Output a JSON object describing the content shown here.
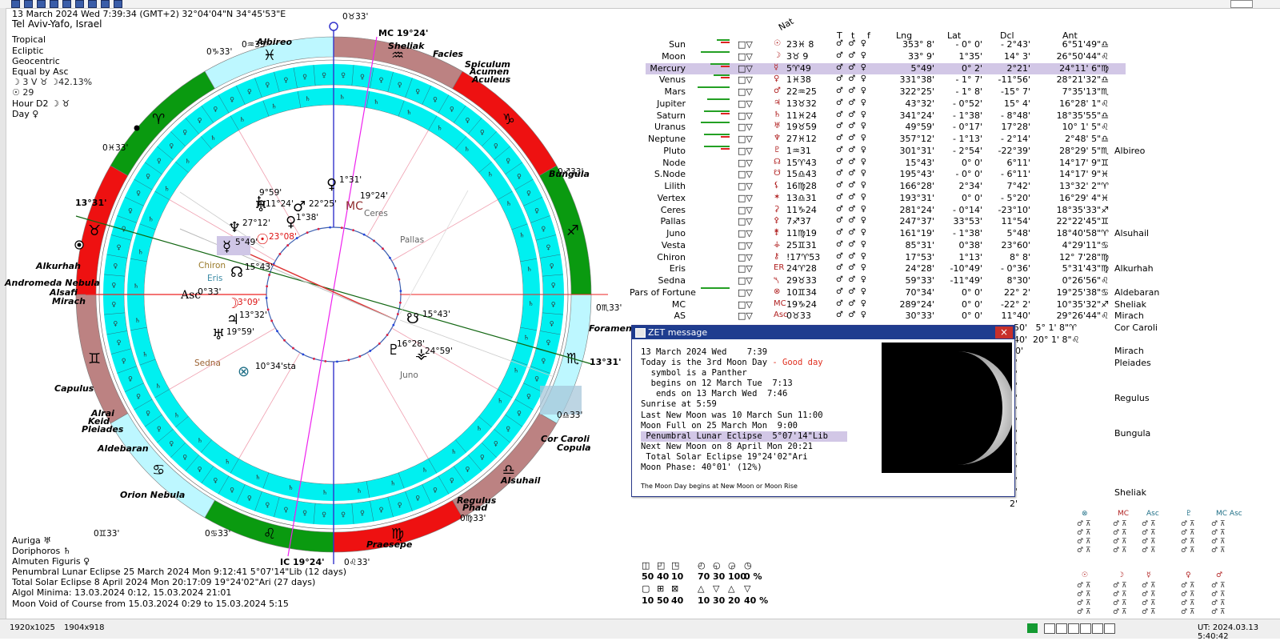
{
  "header": {
    "line1": "13 March 2024  Wed    7:39:34 (GMT+2) 32°04'04\"N  34°45'53\"E",
    "city": "Tel Aviv-Yafo, Israel",
    "settings": [
      "Tropical",
      "Ecliptic",
      "Geocentric",
      "Equal by Asc"
    ],
    "moon_info": "☽  3 V ♉ ☽42.13%",
    "sun_info": "☉  29",
    "hour": "Hour D2 ☽ ♉",
    "day": "Day ♀"
  },
  "wheel": {
    "asc_label": "Asc",
    "asc_deg": "0°33'",
    "mc_label": "MC 19°24'",
    "ic_label": "IC 19°24'",
    "cusp_labels": [
      "0♉33'",
      "0♊33'",
      "0♋33'",
      "0♌33'",
      "0♍33'",
      "0♎33'",
      "0♏33'",
      "0♐33'",
      "0♑33'",
      "0♒33'",
      "0♓33'"
    ],
    "side_degrees": [
      "13°31'",
      "13°31'"
    ],
    "planets": [
      {
        "glyph": "♄",
        "deg": "9°59'"
      },
      {
        "glyph": "♅",
        "deg": "11°24'"
      },
      {
        "glyph": "♂",
        "deg": "22°25'"
      },
      {
        "glyph": "♀",
        "deg": "1°38'"
      },
      {
        "glyph": "♆",
        "deg": "27°12'"
      },
      {
        "glyph": "☿",
        "deg": "5°49'"
      },
      {
        "glyph": "☉",
        "deg": "23°08'"
      },
      {
        "glyph": "☊",
        "deg": "15°43'"
      },
      {
        "glyph": "☽",
        "deg": "3°09'"
      },
      {
        "glyph": "♃",
        "deg": "13°32'"
      },
      {
        "glyph": "♅",
        "deg": "19°59'"
      },
      {
        "glyph": "⊗",
        "deg": "10°34'sta"
      },
      {
        "glyph": "☋",
        "deg": "15°43'"
      },
      {
        "glyph": "♇",
        "deg": "16°28'"
      },
      {
        "glyph": "⚶",
        "deg": "24°59'"
      },
      {
        "glyph": "♀",
        "deg": "1°31'"
      },
      {
        "glyph": "MC",
        "deg": "19°24'"
      }
    ],
    "small_labels": [
      "Chiron",
      "Eris",
      "Sedna",
      "Juno",
      "Ceres",
      "Pallas"
    ],
    "stars": [
      "Albireo",
      "Sheliak",
      "Facies",
      "Spiculum",
      "Acumen",
      "Aculeus",
      "Bungula",
      "Foramen",
      "Cor Caroli",
      "Copula",
      "Alsuhail",
      "Regulus",
      "Phad",
      "Praesepe",
      "Orion Nebula",
      "Aldebaran",
      "Alrai",
      "Keid",
      "Pleiades",
      "Capulus",
      "Alkurhah",
      "Andromeda Nebula",
      "Alsafi",
      "Mirach"
    ],
    "signs": [
      "♒",
      "♑",
      "♐",
      "♏",
      "♎",
      "♍",
      "♌",
      "♋",
      "♊",
      "♉",
      "♈",
      "♓"
    ],
    "colors": {
      "cyan": "#00f0f0",
      "red": "#ee1111",
      "green": "#0a9a10",
      "brown": "#bc8282",
      "lightcyan": "#bdf7ff"
    }
  },
  "table_headers": {
    "nat": "Nat",
    "cols": [
      "T",
      "t",
      "f",
      "Lng",
      "Lat",
      "Dcl",
      "Ant"
    ]
  },
  "planets": [
    {
      "name": "Sun",
      "sign": "☉",
      "pos": "23♓ 8",
      "lng": "353° 8'",
      "lat": "- 0° 0'",
      "dcl": "- 2°43'",
      "ant": "6°51'49\"♎",
      "bar": 0.4,
      "red": true
    },
    {
      "name": "Moon",
      "sign": "☽",
      "pos": "3♉ 9",
      "lng": "33° 9'",
      "lat": "1°35'",
      "dcl": "14° 3'",
      "ant": "26°50'44\"♌",
      "bar": 0.9,
      "red": false
    },
    {
      "name": "Mercury",
      "sign": "☿",
      "pos": "5♈49",
      "lng": "5°49'",
      "lat": "0° 2'",
      "dcl": "2°21'",
      "ant": "24°11' 6\"♍",
      "bar": 0.6,
      "red": true
    },
    {
      "name": "Venus",
      "sign": "♀",
      "pos": "1♓38",
      "lng": "331°38'",
      "lat": "- 1° 7'",
      "dcl": "-11°56'",
      "ant": "28°21'32\"♎",
      "bar": 0.5,
      "red": true
    },
    {
      "name": "Mars",
      "sign": "♂",
      "pos": "22♒25",
      "lng": "322°25'",
      "lat": "- 1° 8'",
      "dcl": "-15° 7'",
      "ant": "7°35'13\"♏",
      "bar": 1.0,
      "red": false
    },
    {
      "name": "Jupiter",
      "sign": "♃",
      "pos": "13♉32",
      "lng": "43°32'",
      "lat": "- 0°52'",
      "dcl": "15° 4'",
      "ant": "16°28' 1\"♌",
      "bar": 0.7,
      "red": false
    },
    {
      "name": "Saturn",
      "sign": "♄",
      "pos": "11♓24",
      "lng": "341°24'",
      "lat": "- 1°38'",
      "dcl": "- 8°48'",
      "ant": "18°35'55\"♎",
      "bar": 0.8,
      "red": true
    },
    {
      "name": "Uranus",
      "sign": "♅",
      "pos": "19♉59",
      "lng": "49°59'",
      "lat": "- 0°17'",
      "dcl": "17°28'",
      "ant": "10° 1' 5\"♌",
      "bar": 0.9,
      "red": false
    },
    {
      "name": "Neptune",
      "sign": "♆",
      "pos": "27♓12",
      "lng": "357°12'",
      "lat": "- 1°13'",
      "dcl": "- 2°14'",
      "ant": "2°48' 5\"♎",
      "bar": 0.8,
      "red": true
    },
    {
      "name": "Pluto",
      "sign": "♇",
      "pos": "1♒31",
      "lng": "301°31'",
      "lat": "- 2°54'",
      "dcl": "-22°39'",
      "ant": "28°29' 5\"♏",
      "bar": 0.8,
      "red": true
    },
    {
      "name": "Node",
      "sign": "☊",
      "pos": "15♈43",
      "lng": "15°43'",
      "lat": "0° 0'",
      "dcl": "6°11'",
      "ant": "14°17' 9\"♊",
      "bar": 0,
      "red": false
    },
    {
      "name": "S.Node",
      "sign": "☋",
      "pos": "15♎43",
      "lng": "195°43'",
      "lat": "- 0° 0'",
      "dcl": "- 6°11'",
      "ant": "14°17' 9\"♓",
      "bar": 0,
      "red": false
    },
    {
      "name": "Lilith",
      "sign": "⚸",
      "pos": "16♍28",
      "lng": "166°28'",
      "lat": "2°34'",
      "dcl": "7°42'",
      "ant": "13°32' 2\"♈",
      "bar": 0,
      "red": false
    },
    {
      "name": "Vertex",
      "sign": "✶",
      "pos": "13♎31",
      "lng": "193°31'",
      "lat": "0° 0'",
      "dcl": "- 5°20'",
      "ant": "16°29' 4\"♓",
      "bar": 0,
      "red": false
    },
    {
      "name": "Ceres",
      "sign": "⚳",
      "pos": "11♑24",
      "lng": "281°24'",
      "lat": "- 0°14'",
      "dcl": "-23°10'",
      "ant": "18°35'33\"♐",
      "bar": 0,
      "red": false
    },
    {
      "name": "Pallas",
      "sign": "⚴",
      "pos": "7♐37",
      "lng": "247°37'",
      "lat": "33°53'",
      "dcl": "11°54'",
      "ant": "22°22'45\"♊",
      "bar": 0,
      "red": false
    },
    {
      "name": "Juno",
      "sign": "⚵",
      "pos": "11♍19",
      "lng": "161°19'",
      "lat": "- 1°38'",
      "dcl": "5°48'",
      "ant": "18°40'58\"♈",
      "bar": 0,
      "red": false
    },
    {
      "name": "Vesta",
      "sign": "⚶",
      "pos": "25♊31",
      "lng": "85°31'",
      "lat": "0°38'",
      "dcl": "23°60'",
      "ant": "4°29'11\"♋",
      "bar": 0,
      "red": false
    },
    {
      "name": "Chiron",
      "sign": "⚷",
      "pos": "!17♈53",
      "lng": "17°53'",
      "lat": "1°13'",
      "dcl": "8° 8'",
      "ant": "12° 7'28\"♍",
      "bar": 0,
      "red": false
    },
    {
      "name": "Eris",
      "sign": "ER",
      "pos": "24♈28",
      "lng": "24°28'",
      "lat": "-10°49'",
      "dcl": "- 0°36'",
      "ant": "5°31'43\"♍",
      "bar": 0,
      "red": false
    },
    {
      "name": "Sedna",
      "sign": "⯲",
      "pos": "29♉33",
      "lng": "59°33'",
      "lat": "-11°49'",
      "dcl": "8°30'",
      "ant": "0°26'56\"♌",
      "bar": 0,
      "red": false
    },
    {
      "name": "Pars of Fortune",
      "sign": "⊗",
      "pos": "10♊34",
      "lng": "70°34'",
      "lat": "0° 0'",
      "dcl": "22° 2'",
      "ant": "19°25'38\"♋",
      "bar": 0.9,
      "red": false
    },
    {
      "name": "MC",
      "sign": "MC",
      "pos": "19♑24",
      "lng": "289°24'",
      "lat": "0° 0'",
      "dcl": "-22° 2'",
      "ant": "10°35'32\"♐",
      "bar": 0,
      "red": false
    },
    {
      "name": "AS",
      "sign": "Asc",
      "pos": "0♉33",
      "lng": "30°33'",
      "lat": "0° 0'",
      "dcl": "11°40'",
      "ant": "29°26'44\"♌",
      "bar": 0,
      "red": false
    }
  ],
  "table_stars": [
    {
      "row": 9,
      "name": "Albireo"
    },
    {
      "row": 16,
      "name": "Alsuhail"
    },
    {
      "row": 19,
      "name": "Alkurhah"
    },
    {
      "row": 21,
      "name": "Aldebaran"
    },
    {
      "row": 22,
      "name": "Sheliak"
    },
    {
      "row": 23,
      "name": "Mirach"
    }
  ],
  "extra_rows": [
    {
      "text": "50'   5° 1' 8\"♈",
      "star": "Cor Caroli"
    },
    {
      "text": "40'  20° 1' 8\"♌",
      "star": ""
    }
  ],
  "behind_popup": [
    "40'",
    "6'",
    "0'",
    "2'",
    "7'",
    "0'",
    "2'",
    "6'",
    "2'",
    "8'",
    "2'",
    "5'",
    "3'",
    "2'"
  ],
  "right_stars": [
    "Mirach",
    "Pleiades",
    "Regulus",
    "Bungula",
    "Sheliak"
  ],
  "popup": {
    "title": "ZET message",
    "close": "×",
    "lines": [
      "13 March 2024 Wed    7:39",
      "Today is the 3rd Moon Day",
      "  symbol is a Panther",
      "  begins on 12 March Tue  7:13",
      "   ends on 13 March Wed  7:46",
      "Sunrise at 5:59",
      "Last New Moon was 10 March Sun 11:00",
      "Moon Full on 25 March Mon  9:00",
      " Penumbral Lunar Eclipse  5°07'14\"Lib",
      "Next New Moon on 8 April Mon 20:21",
      " Total Solar Eclipse 19°24'02\"Ari",
      "Moon Phase: 40°01' (12%)"
    ],
    "good_day": " - Good day",
    "footnote": "The Moon Day begins at New Moon or Moon Rise"
  },
  "bottom_left": [
    "Auriga  ♅",
    "Doriphoros  ♄",
    "Almuten Figuris  ♀",
    "Penumbral Lunar Eclipse 25 March 2024 Mon  9:12:41  5°07'14\"Lib (12 days)",
    "Total Solar Eclipse 8 April 2024 Mon 20:17:09 19°24'02\"Ari (27 days)",
    "Algol Minima: 13.03.2024  0:12,  15.03.2024 21:01",
    "Moon Void of Course from 15.03.2024  0:29 to 15.03.2024  5:15"
  ],
  "bottom_mid": {
    "row1_glyphs": [
      "◫",
      "◰",
      "◳",
      "◴",
      "◵",
      "◶",
      "◷"
    ],
    "row1_vals": [
      "50",
      "40",
      "10",
      "70",
      "30",
      "100",
      "0 %"
    ],
    "row2_glyphs": [
      "▢",
      "⊞",
      "⊠",
      "△",
      "▽",
      "△",
      "▽"
    ],
    "row2_vals": [
      "10",
      "50",
      "40",
      "10",
      "30",
      "20",
      "40 %"
    ]
  },
  "aspect_grid": {
    "heads": [
      "⊗",
      "MC",
      "Asc",
      "♇",
      "MC Asc",
      "☉",
      "☽",
      "☿",
      "♀",
      "♂"
    ]
  },
  "status": {
    "screen": "1920x1025",
    "view": "1904x918",
    "ut": "UT: 2024.03.13  5:40:42"
  }
}
